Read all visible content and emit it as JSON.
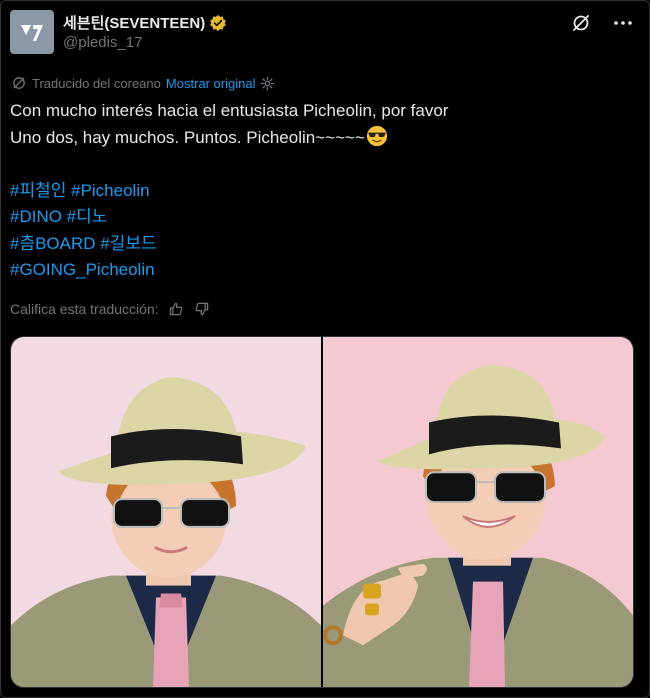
{
  "account": {
    "name": "세븐틴(SEVENTEEN)",
    "handle": "@pledis_17",
    "verified_color": "#e8b92a",
    "avatar_icon": "seventeen-logo"
  },
  "header_icons": [
    "grok-icon",
    "more-icon"
  ],
  "translation": {
    "label": "Traducido del coreano",
    "link": "Mostrar original",
    "settings_icon": "gear-icon"
  },
  "tweet": {
    "line1": "Con mucho interés hacia el entusiasta Picheolin, por favor",
    "line2": "Uno dos, hay muchos. Puntos. Picheolin~~~~~",
    "emoji": "smiling-face-with-sunglasses",
    "hashtags": [
      [
        "#피철인",
        "#Picheolin"
      ],
      [
        "#DINO",
        "#디노"
      ],
      [
        "#츰BOARD",
        "#길보드"
      ],
      [
        "#GOING_Picheolin"
      ]
    ]
  },
  "rating": {
    "label": "Califica esta traducción:",
    "icons": [
      "thumbs-up-icon",
      "thumbs-down-icon"
    ]
  },
  "media": {
    "count": 2,
    "colors": {
      "background_left": "#f3d9e2",
      "background_right": "#f4c9d2",
      "hat": "#dcd6a6",
      "band": "#1b1b1b",
      "suit": "#9a9a78",
      "shirt": "#1c2a48",
      "tie": "#e7a3b8"
    }
  }
}
